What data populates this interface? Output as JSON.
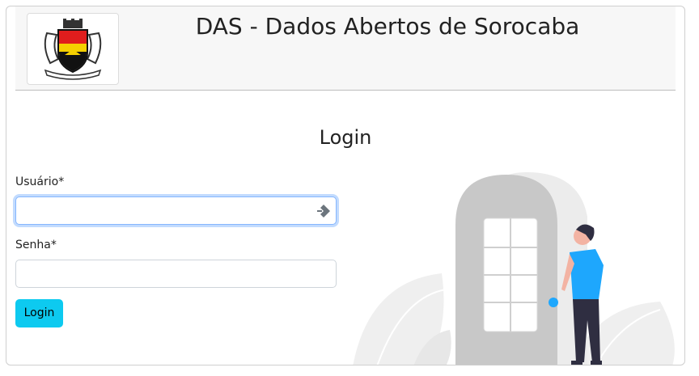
{
  "header": {
    "title": "DAS - Dados Abertos de Sorocaba",
    "logo_name": "sorocaba-coat-of-arms"
  },
  "login": {
    "title": "Login",
    "username_label": "Usuário*",
    "username_value": "",
    "password_label": "Senha*",
    "password_value": "",
    "submit_label": "Login"
  },
  "colors": {
    "primary_button": "#0dcaf0",
    "focus_border": "#86b7fe",
    "illustration_accent": "#1ea7fd"
  }
}
